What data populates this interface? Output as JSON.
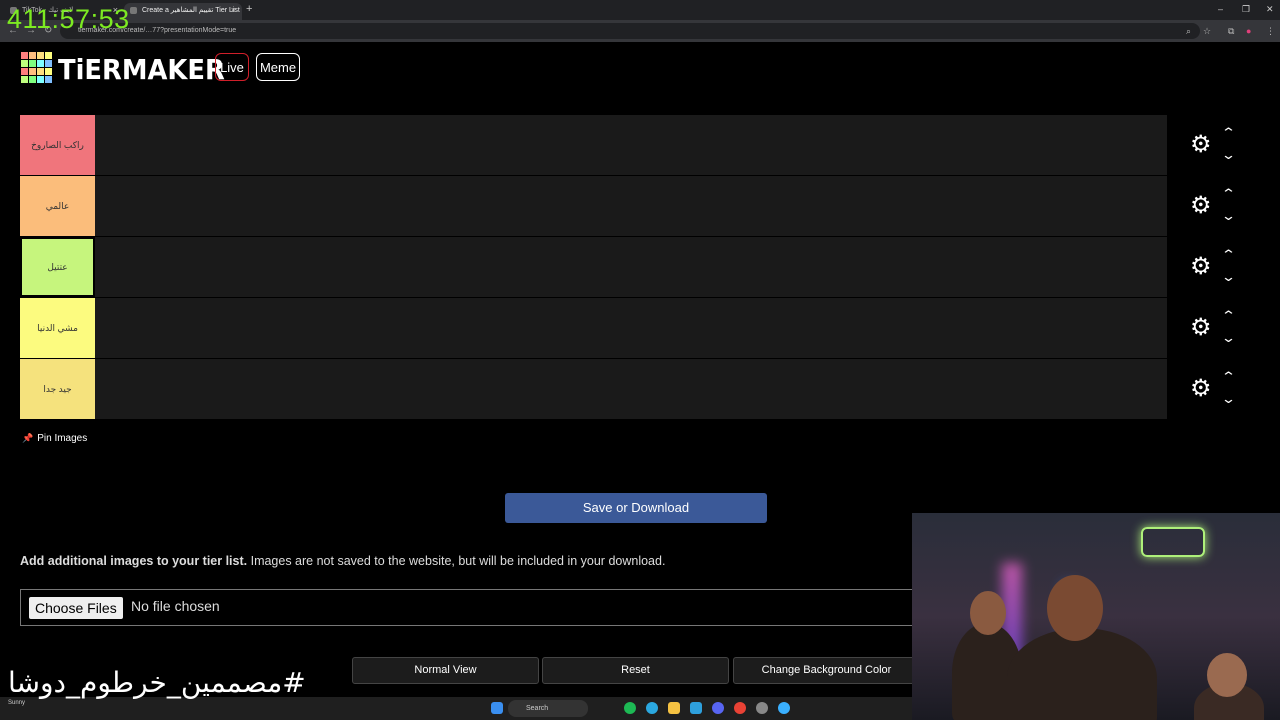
{
  "browser": {
    "tabs": [
      {
        "label": "TikTok - لايف تيك"
      },
      {
        "label": "Create a تقييم المشاهير Tier List"
      }
    ],
    "url": "tiermaker.com/create/…77?presentationMode=true"
  },
  "overlay": {
    "timer": "411:57:53",
    "hashtag": "#مصممين_خرطوم_دوشا"
  },
  "header": {
    "logo_text": "TiERMAKER",
    "live_label": "Live",
    "meme_label": "Meme"
  },
  "tiers": [
    {
      "label": "راكب الصاروخ",
      "color": "#f0757c"
    },
    {
      "label": "عالمي",
      "color": "#fbbd7b"
    },
    {
      "label": "عتتيل",
      "color": "#c6f57d"
    },
    {
      "label": "مشي الدنيا",
      "color": "#fcfb7f"
    },
    {
      "label": "جيد جدا",
      "color": "#f5e27d"
    }
  ],
  "pin_images_label": "Pin Images",
  "save_button_label": "Save or Download",
  "add_images": {
    "bold": "Add additional images to your tier list.",
    "rest": " Images are not saved to the website, but will be included in your download."
  },
  "file_input": {
    "button_label": "Choose Files",
    "status": "No file chosen"
  },
  "bottom_buttons": {
    "normal_view": "Normal View",
    "reset": "Reset",
    "change_bg": "Change Background Color"
  },
  "taskbar": {
    "search_label": "Search",
    "weather": "Sunny"
  },
  "colors": {
    "save_button": "#3b5998",
    "live_border": "#d01f2a",
    "timer": "#7dea22"
  }
}
